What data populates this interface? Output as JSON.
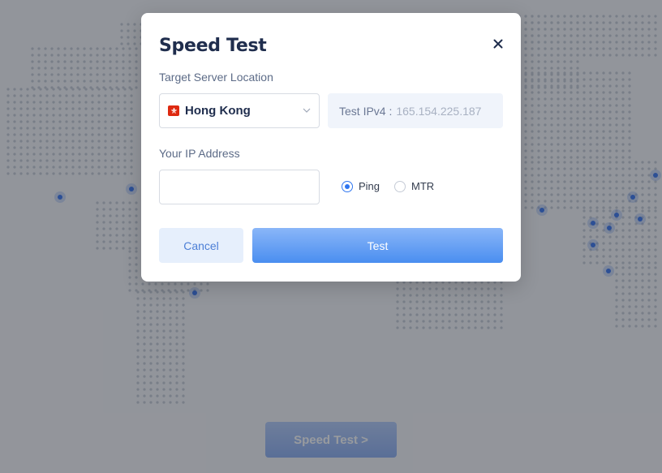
{
  "background": {
    "button_label": "Speed Test >"
  },
  "modal": {
    "title": "Speed Test",
    "close_icon": "close-icon",
    "target_label": "Target Server Location",
    "location": {
      "value": "Hong Kong",
      "flag_icon": "hong-kong-flag-icon"
    },
    "ipv4": {
      "label": "Test IPv4 :",
      "value": "165.154.225.187"
    },
    "ip_label": "Your IP Address",
    "ip_input": {
      "value": "",
      "placeholder": ""
    },
    "test_types": [
      {
        "label": "Ping",
        "selected": true
      },
      {
        "label": "MTR",
        "selected": false
      }
    ],
    "cancel_label": "Cancel",
    "test_label": "Test"
  },
  "colors": {
    "primary": "#2f76f0",
    "title": "#1f2d4d",
    "flag": "#de2910"
  }
}
